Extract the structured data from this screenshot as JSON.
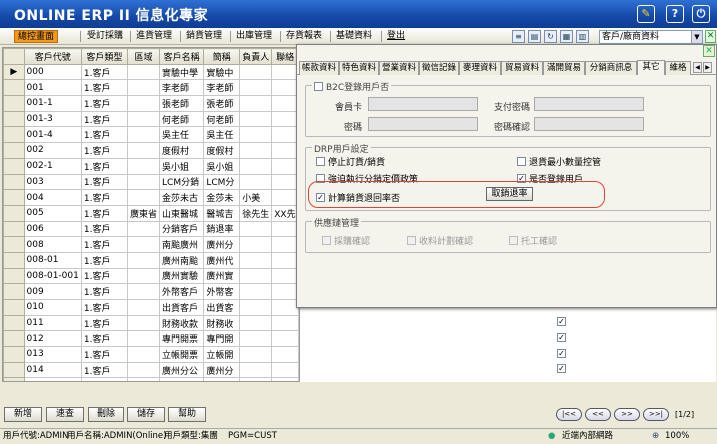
{
  "titlebar": {
    "brand": "ONLINE ERP II 信息化專家",
    "edit_icon": "✎",
    "help_icon": "?",
    "power_icon": "⏻"
  },
  "menu": {
    "items": [
      {
        "label": "總控畫面",
        "active": true
      },
      {
        "label": "受訂採購"
      },
      {
        "label": "進貨管理"
      },
      {
        "label": "銷貨管理"
      },
      {
        "label": "出庫管理"
      },
      {
        "label": "存貨報表"
      },
      {
        "label": "基礎資料"
      },
      {
        "label": "登出"
      }
    ]
  },
  "toolbar": {
    "combo_value": "客戶/廠商資料"
  },
  "grid": {
    "columns": [
      "客戶代號",
      "客戶類型",
      "區域",
      "客戶名稱",
      "簡稱",
      "負責人",
      "聯絡"
    ],
    "rows": [
      [
        "000",
        "1.客戶",
        "",
        "實驗中學",
        "實驗中",
        "",
        ""
      ],
      [
        "001",
        "1.客戶",
        "",
        "李老師",
        "李老師",
        "",
        ""
      ],
      [
        "001-1",
        "1.客戶",
        "",
        "張老師",
        "張老師",
        "",
        ""
      ],
      [
        "001-3",
        "1.客戶",
        "",
        "何老師",
        "何老師",
        "",
        ""
      ],
      [
        "001-4",
        "1.客戶",
        "",
        "吳主任",
        "吳主任",
        "",
        ""
      ],
      [
        "002",
        "1.客戶",
        "",
        "度假村",
        "度假村",
        "",
        ""
      ],
      [
        "002-1",
        "1.客戶",
        "",
        "吳小姐",
        "吳小姐",
        "",
        ""
      ],
      [
        "003",
        "1.客戶",
        "",
        "LCM分銷",
        "LCM分",
        "",
        ""
      ],
      [
        "004",
        "1.客戶",
        "",
        "金莎未古",
        "金莎未",
        "小美",
        ""
      ],
      [
        "005",
        "1.客戶",
        "廣東省",
        "山東醫城",
        "醫城吉",
        "徐先生",
        "XX先"
      ],
      [
        "006",
        "1.客戶",
        "",
        "分銷客戶",
        "銷退率",
        "",
        ""
      ],
      [
        "008",
        "1.客戶",
        "",
        "南颱廣州",
        "廣州分",
        "",
        ""
      ],
      [
        "008-01",
        "1.客戶",
        "",
        "廣州南颱",
        "廣州代",
        "",
        ""
      ],
      [
        "008-01-001",
        "1.客戶",
        "",
        "廣州實驗",
        "廣州實",
        "",
        ""
      ],
      [
        "009",
        "1.客戶",
        "",
        "外幣客戶",
        "外幣客",
        "",
        ""
      ],
      [
        "010",
        "1.客戶",
        "",
        "出貨客戶",
        "出貨客",
        "",
        ""
      ],
      [
        "011",
        "1.客戶",
        "",
        "財務收款",
        "財務收",
        "",
        ""
      ],
      [
        "012",
        "1.客戶",
        "",
        "專門開票",
        "專門開",
        "",
        ""
      ],
      [
        "013",
        "1.客戶",
        "",
        "立帳開票",
        "立帳開",
        "",
        ""
      ],
      [
        "014",
        "1.客戶",
        "",
        "廣州分公",
        "廣州分",
        "",
        ""
      ]
    ],
    "current_marker": "▶",
    "new_marker": "*"
  },
  "dialog": {
    "close": "✕",
    "tabs": [
      "帳款資料",
      "特色資料",
      "營業資料",
      "徵信記錄",
      "麥理資料",
      "貿易資料",
      "滿開貿易",
      "分銷商訊息",
      "其它",
      "維格"
    ],
    "active_tab": 8,
    "b2c": {
      "title": "B2C登錄用戶否",
      "member_label": "會員卡",
      "pay_pwd_label": "支付密碼",
      "pwd_label": "密碼",
      "pwd_confirm_label": "密碼確認"
    },
    "drp": {
      "title": "DRP用戶設定",
      "stop_order": "停止訂貨/銷貨",
      "min_qty": "退貨最小數量控管",
      "force_price": "強迫執行分銷定價政策",
      "drp_login": "是否登錄用戶",
      "calc_return": "計算銷貨退回率否",
      "cancel_return": "取銷退率"
    },
    "supply": {
      "title": "供應鏈管理",
      "purchase": "採購確認",
      "receipt": "收料計劃確認",
      "consign": "托工確認"
    }
  },
  "bottom": {
    "new": "新增",
    "query": "速查",
    "delete": "刪除",
    "save": "儲存",
    "help": "幫助",
    "first": "|<<",
    "prev": "<<",
    "next": ">>",
    "last": ">>|",
    "page": "[1/2]"
  },
  "status": {
    "user_id": "用戶代號:ADMIN",
    "user_name": "用戶名稱:ADMIN(Online)",
    "user_type": "用戶類型:集團",
    "pgm": "PGM=CUST",
    "network": "近端內部網路",
    "zoom": "100%"
  }
}
